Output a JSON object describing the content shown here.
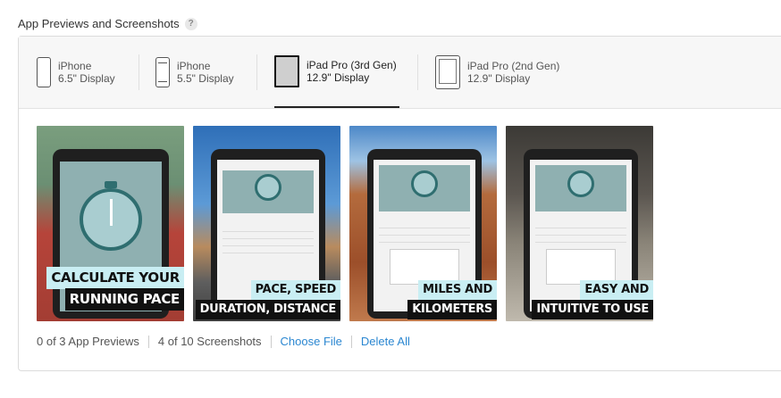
{
  "section": {
    "title": "App Previews and Screenshots",
    "help": "?"
  },
  "devices": [
    {
      "name": "iPhone",
      "size": "6.5\" Display",
      "icon": "iphone-icon"
    },
    {
      "name": "iPhone",
      "size": "5.5\" Display",
      "icon": "iphone-home-button-icon"
    },
    {
      "name": "iPad Pro (3rd Gen)",
      "size": "12.9\" Display",
      "icon": "ipad-pro-icon",
      "selected": true
    },
    {
      "name": "iPad Pro (2nd Gen)",
      "size": "12.9\" Display",
      "icon": "ipad-icon"
    }
  ],
  "screenshots": [
    {
      "caption1": "CALCULATE YOUR",
      "caption2": "RUNNING PACE"
    },
    {
      "caption1": "PACE, SPEED",
      "caption2": "DURATION, DISTANCE"
    },
    {
      "caption1": "MILES AND",
      "caption2": "KILOMETERS"
    },
    {
      "caption1": "EASY AND",
      "caption2": "INTUITIVE TO USE"
    }
  ],
  "footer": {
    "previews": "0 of 3 App Previews",
    "screenshots": "4 of 10 Screenshots",
    "choose_file": "Choose File",
    "delete_all": "Delete All"
  },
  "colors": {
    "link": "#2b87d1",
    "caption_light": "#c9eef3",
    "caption_dark": "#111111"
  }
}
